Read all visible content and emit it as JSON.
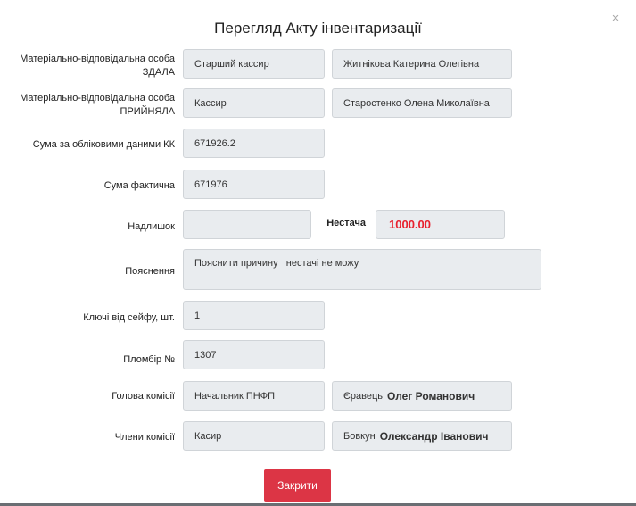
{
  "title": "Перегляд Акту інвентаризації",
  "close_glyph": "×",
  "rows": {
    "handed": {
      "label_1": "Матеріально-відповідальна особа",
      "label_2": "ЗДАЛА",
      "position": "Старший кассир",
      "name": "Житнікова Катерина Олегівна"
    },
    "received": {
      "label_1": "Матеріально-відповідальна особа",
      "label_2": "ПРИЙНЯЛА",
      "position": "Кассир",
      "name": "Старостенко Олена Миколаївна"
    },
    "book_sum": {
      "label": "Сума за обліковими даними КК",
      "value": "671926.2"
    },
    "actual_sum": {
      "label": "Сума фактична",
      "value": "671976"
    },
    "surplus": {
      "label": "Надлишок",
      "value": ""
    },
    "shortage": {
      "label": "Нестача",
      "value": "1000.00"
    },
    "explanation": {
      "label": "Пояснення",
      "value": "Пояснити причину   нестачі не можу"
    },
    "keys": {
      "label": "Ключі від сейфу, шт.",
      "value": "1"
    },
    "seal": {
      "label": "Пломбір №",
      "value": "1307"
    },
    "chairman": {
      "label": "Голова комісії",
      "position": "Начальник ПНФП",
      "name_prefix": "Єравець",
      "name_bold": "Олег Романович"
    },
    "members": {
      "label": "Члени комісії",
      "position": "Касир",
      "name_prefix": "Бовкун",
      "name_bold": "Олександр Іванович"
    }
  },
  "close_button": "Закрити",
  "colors": {
    "accent": "#dc3545",
    "shortage": "#e8212e",
    "field_bg": "#e9ecef"
  }
}
